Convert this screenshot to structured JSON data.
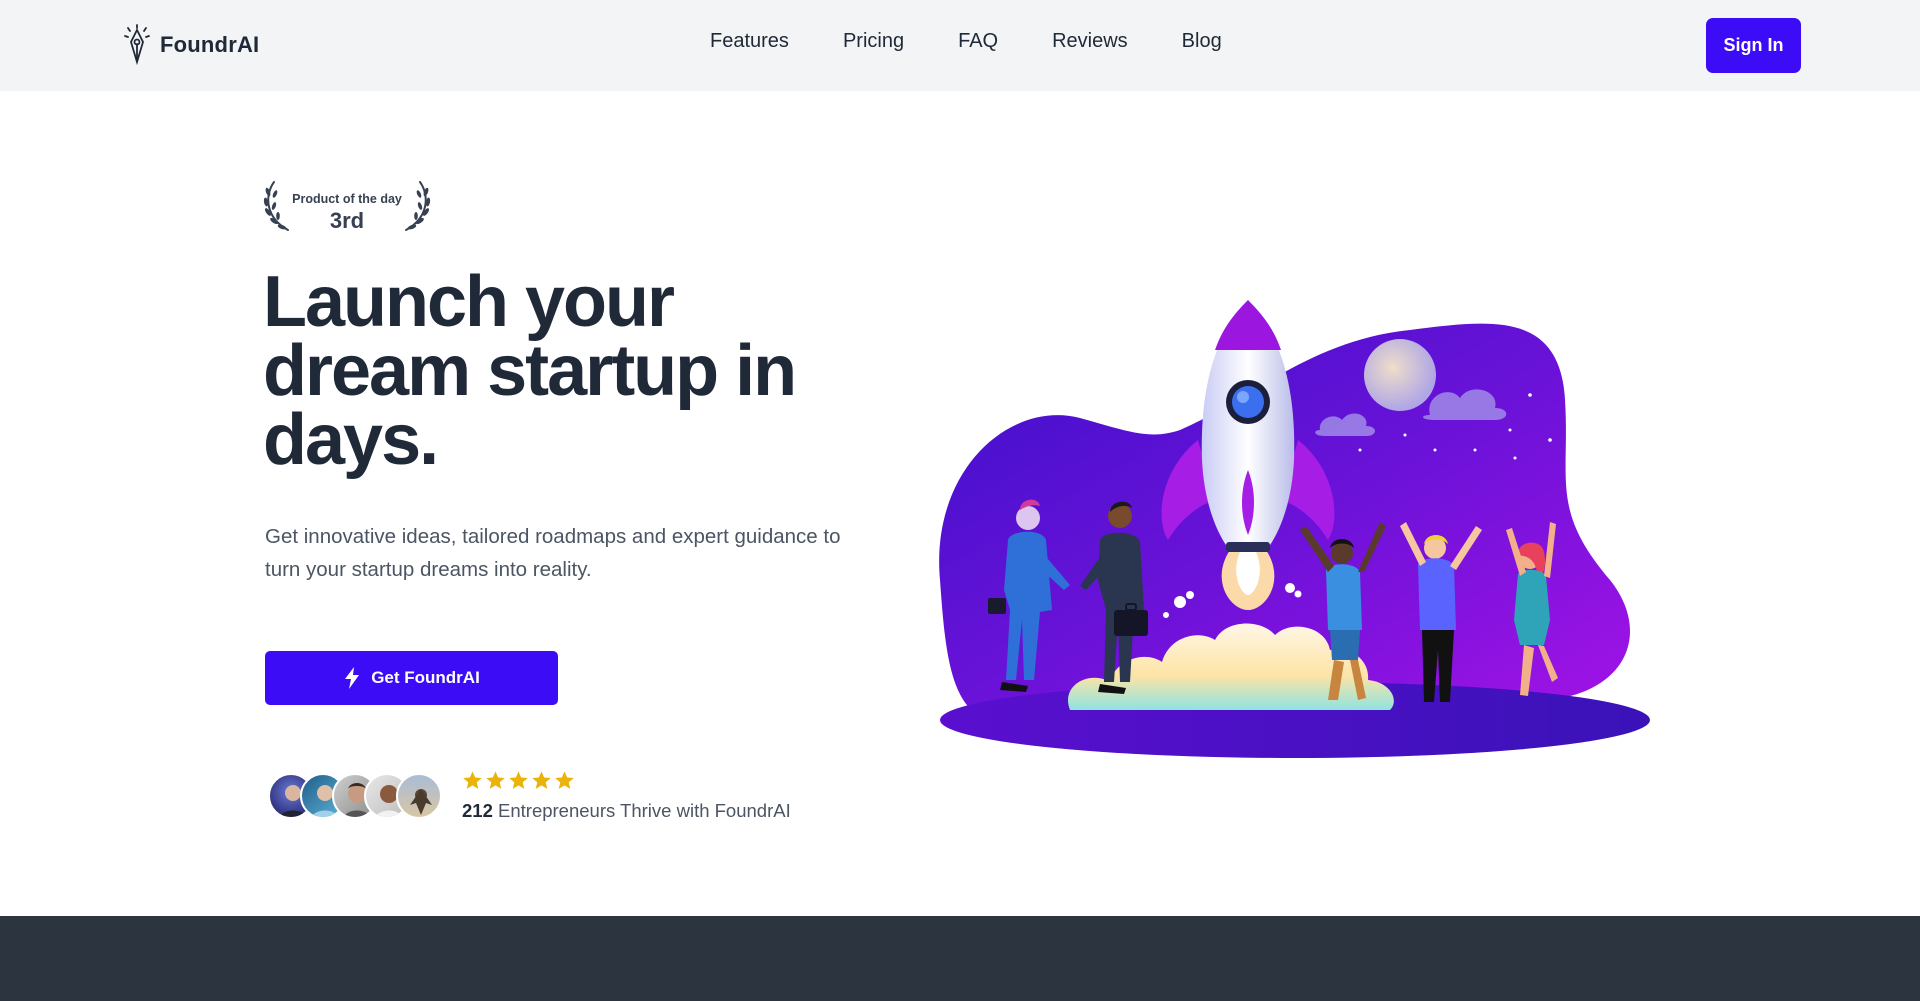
{
  "brand": {
    "name": "FoundrAI",
    "logo_icon": "pen-nib-icon"
  },
  "nav": {
    "links": [
      {
        "label": "Features"
      },
      {
        "label": "Pricing"
      },
      {
        "label": "FAQ"
      },
      {
        "label": "Reviews"
      },
      {
        "label": "Blog"
      }
    ],
    "signin_label": "Sign In"
  },
  "award": {
    "title": "Product of the day",
    "rank": "3rd"
  },
  "hero": {
    "headline": "Launch your dream startup in days.",
    "subtext": "Get innovative ideas, tailored roadmaps and expert guidance to turn your startup dreams into reality.",
    "cta_label": "Get FoundrAI",
    "cta_icon": "lightning-bolt-icon"
  },
  "social_proof": {
    "rating_stars": 5,
    "count": "212",
    "text": "Entrepreneurs Thrive with FoundrAI"
  },
  "colors": {
    "accent": "#3b0cf5",
    "nav_bg": "#f3f4f6",
    "heading": "#1f2937",
    "body_text": "#4b5563",
    "star": "#eab308",
    "footer_band": "#2c3440"
  }
}
